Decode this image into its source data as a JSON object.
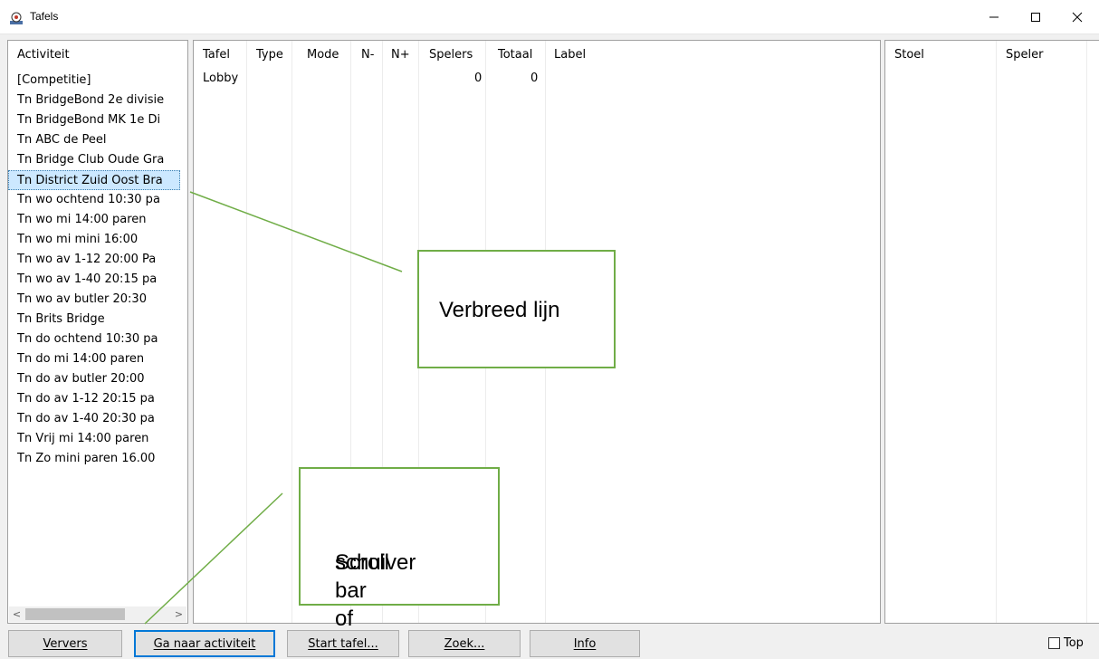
{
  "window": {
    "title": "Tafels",
    "minimize_glyph": "–",
    "maximize_glyph": "☐",
    "close_glyph": "✕"
  },
  "activity_panel": {
    "header": "Activiteit",
    "items": [
      "[Competitie]",
      "Tn BridgeBond 2e divisie",
      "Tn BridgeBond MK 1e Di",
      "Tn ABC de Peel",
      "Tn Bridge Club Oude Gra",
      "Tn District Zuid Oost Bra",
      "Tn wo ochtend 10:30 pa",
      "Tn wo mi 14:00 paren",
      "Tn wo mi mini 16:00",
      "Tn wo av 1-12 20:00 Pa",
      "Tn wo av 1-40 20:15 pa",
      "Tn wo av butler 20:30",
      "Tn Brits Bridge",
      "Tn do ochtend 10:30 pa",
      "Tn do mi 14:00 paren",
      "Tn do av butler 20:00",
      "Tn do av 1-12 20:15 pa",
      "Tn do av 1-40 20:30 pa",
      "Tn Vrij mi 14:00 paren",
      "Tn Zo mini paren 16.00"
    ],
    "selected_index": 5,
    "scroll_left": "<",
    "scroll_right": ">"
  },
  "tables_panel": {
    "columns": [
      "Tafel",
      "Type",
      "Mode",
      "N-",
      "N+",
      "Spelers",
      "Totaal",
      "Label"
    ],
    "rows": [
      {
        "tafel": "Lobby",
        "type": "",
        "mode": "",
        "n_min": "",
        "n_plus": "",
        "spelers": "0",
        "totaal": "0",
        "label": ""
      }
    ]
  },
  "seats_panel": {
    "columns": [
      "Stoel",
      "Speler"
    ]
  },
  "buttons": {
    "refresh": "Ververs",
    "goto_activity": "Ga naar activiteit",
    "start_table": "Start tafel...",
    "search": "Zoek...",
    "info": "Info"
  },
  "top_checkbox": {
    "label": "Top",
    "checked": false
  },
  "annotations": {
    "callout_1": "Verbreed lijn",
    "callout_2_line1": "Scroll bar of",
    "callout_2_line2": "schuiver",
    "line_color": "#70ad47"
  },
  "colors": {
    "selection_bg": "#cce8ff",
    "default_button_border": "#0078d7"
  }
}
